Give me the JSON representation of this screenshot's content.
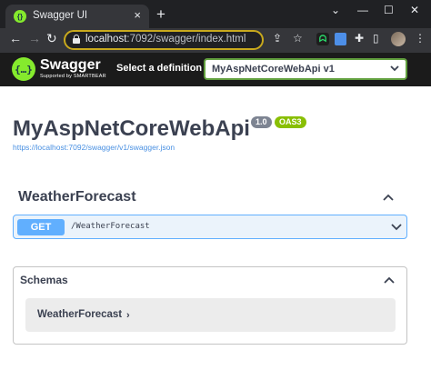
{
  "browser": {
    "tab_title": "Swagger UI",
    "tab_close": "×",
    "new_tab": "+",
    "url_host": "localhost",
    "url_path": ":7092/swagger/index.html",
    "controls": {
      "menu": "⌄",
      "minimize": "—",
      "maximize": "☐",
      "close": "✕"
    }
  },
  "header": {
    "logo_text": "Swagger",
    "logo_glyph": "{…}",
    "logo_sub": "Supported by SMARTBEAR",
    "definition_label": "Select a definition",
    "definition_value": "MyAspNetCoreWebApi v1"
  },
  "info": {
    "title": "MyAspNetCoreWebApi",
    "version": "1.0",
    "oas": "OAS3",
    "spec_url": "https://localhost:7092/swagger/v1/swagger.json"
  },
  "tag": {
    "name": "WeatherForecast",
    "operations": [
      {
        "method": "GET",
        "path": "/WeatherForecast"
      }
    ]
  },
  "schemas": {
    "title": "Schemas",
    "models": [
      {
        "name": "WeatherForecast",
        "arrow": "›"
      }
    ]
  },
  "colors": {
    "get": "#61affe",
    "swagger_green": "#85ea2d",
    "oas_badge": "#89bf04",
    "text": "#3b4151"
  }
}
